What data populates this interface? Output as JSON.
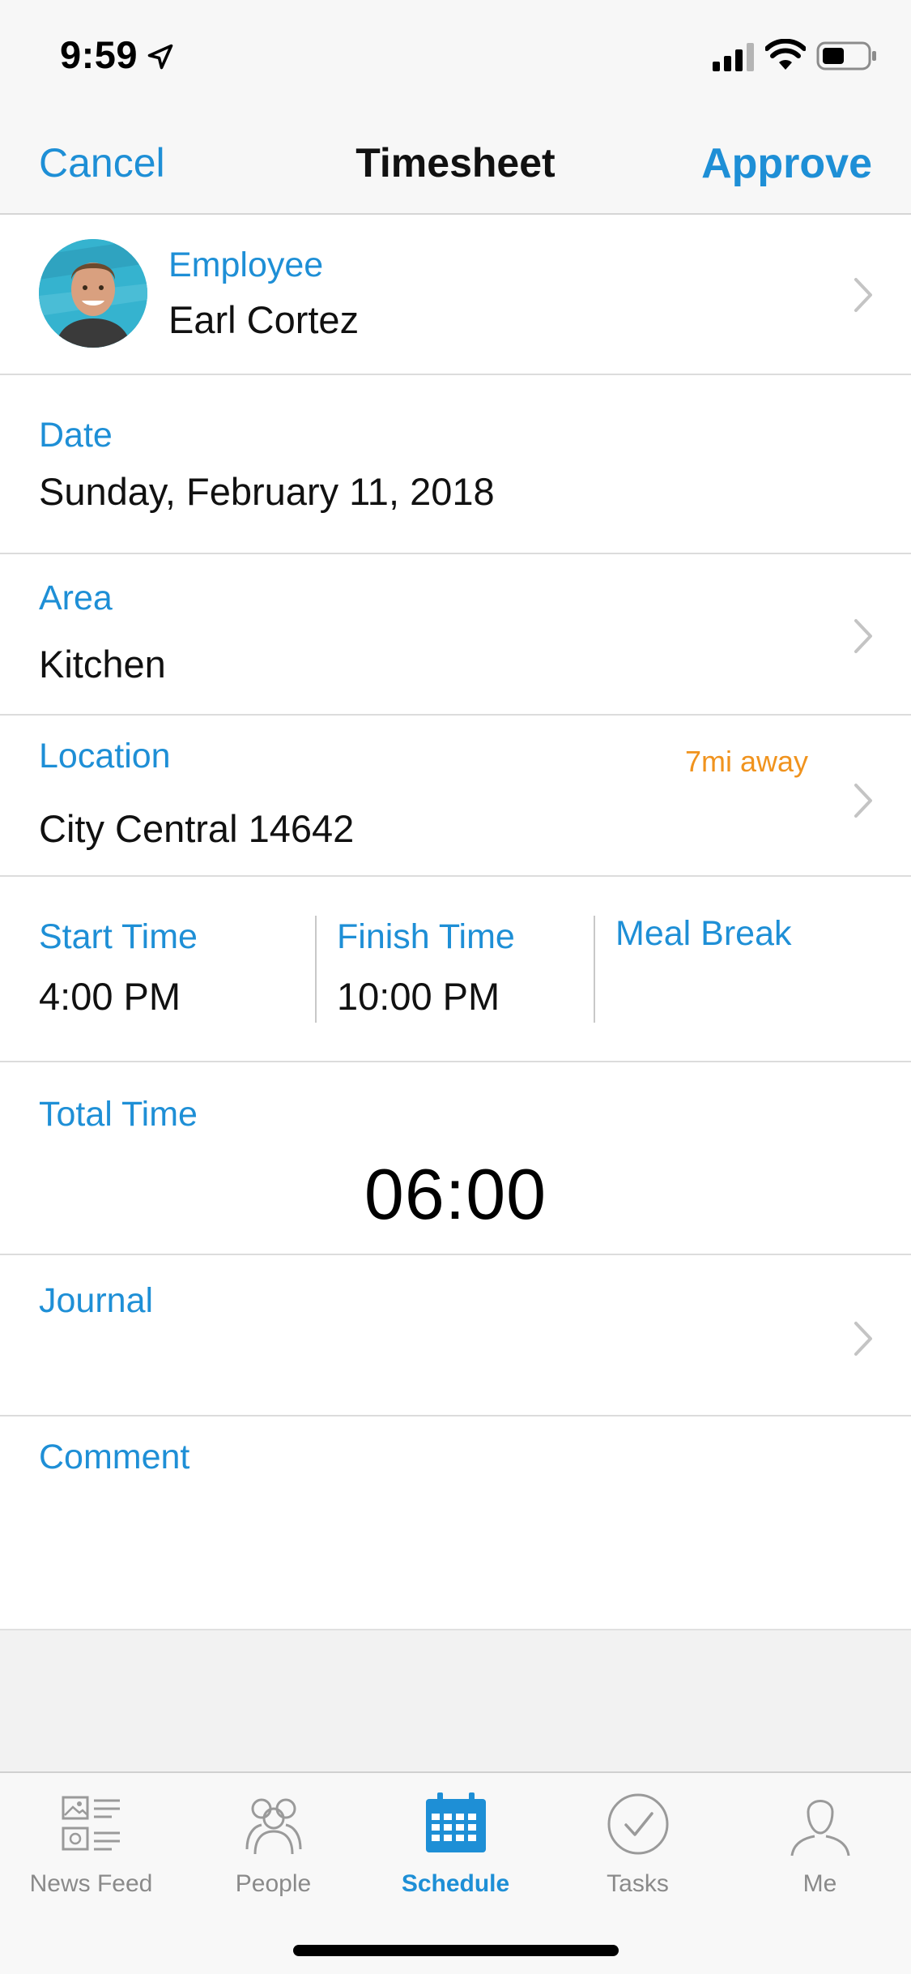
{
  "status": {
    "time": "9:59"
  },
  "nav": {
    "cancel": "Cancel",
    "title": "Timesheet",
    "approve": "Approve"
  },
  "employee": {
    "label": "Employee",
    "name": "Earl Cortez"
  },
  "date": {
    "label": "Date",
    "value": "Sunday, February 11, 2018"
  },
  "area": {
    "label": "Area",
    "value": "Kitchen"
  },
  "location": {
    "label": "Location",
    "value": "City Central 14642",
    "distance": "7mi away"
  },
  "times": {
    "start_label": "Start Time",
    "start_value": "4:00 PM",
    "finish_label": "Finish Time",
    "finish_value": "10:00 PM",
    "meal_label": "Meal Break"
  },
  "total": {
    "label": "Total Time",
    "value": "06:00"
  },
  "journal": {
    "label": "Journal"
  },
  "comment": {
    "label": "Comment"
  },
  "tabs": [
    {
      "label": "News Feed",
      "icon": "news-feed-icon"
    },
    {
      "label": "People",
      "icon": "people-icon"
    },
    {
      "label": "Schedule",
      "icon": "calendar-icon",
      "active": true
    },
    {
      "label": "Tasks",
      "icon": "check-circle-icon"
    },
    {
      "label": "Me",
      "icon": "user-icon"
    }
  ],
  "colors": {
    "accent": "#1e8fd6",
    "distance": "#f0931e"
  }
}
